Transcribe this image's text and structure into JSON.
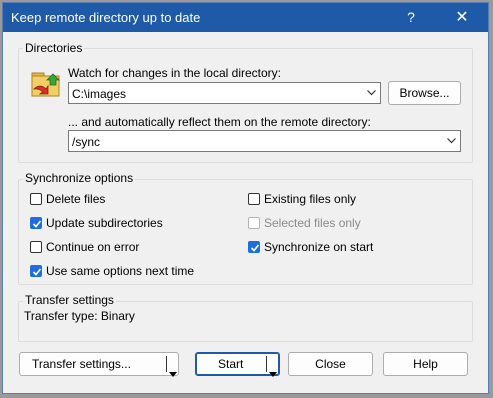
{
  "window": {
    "title": "Keep remote directory up to date",
    "help_glyph": "?",
    "close_glyph": "✕"
  },
  "directories": {
    "group_title": "Directories",
    "local_label": "Watch for changes in the local directory:",
    "local_value": "C:\\images",
    "browse_label": "Browse...",
    "remote_label": "... and automatically reflect them on the remote directory:",
    "remote_value": "/sync"
  },
  "sync_options": {
    "group_title": "Synchronize options",
    "delete_files": {
      "label": "Delete files",
      "checked": false,
      "enabled": true
    },
    "update_subdirectories": {
      "label": "Update subdirectories",
      "checked": true,
      "enabled": true
    },
    "continue_on_error": {
      "label": "Continue on error",
      "checked": false,
      "enabled": true
    },
    "use_same_options": {
      "label": "Use same options next time",
      "checked": true,
      "enabled": true
    },
    "existing_files_only": {
      "label": "Existing files only",
      "checked": false,
      "enabled": true
    },
    "selected_files_only": {
      "label": "Selected files only",
      "checked": false,
      "enabled": false
    },
    "synchronize_on_start": {
      "label": "Synchronize on start",
      "checked": true,
      "enabled": true
    }
  },
  "transfer": {
    "group_title": "Transfer settings",
    "type_text": "Transfer type: Binary"
  },
  "buttons": {
    "transfer_settings": "Transfer settings...",
    "start": "Start",
    "close": "Close",
    "help": "Help"
  },
  "colors": {
    "titlebar": "#1e5aa8",
    "checkbox_checked": "#1e6fd9"
  }
}
